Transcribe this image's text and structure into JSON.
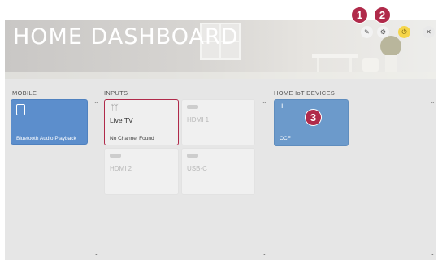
{
  "header": {
    "title": "HOME DASHBOARD",
    "buttons": {
      "edit_icon": "pencil-icon",
      "settings_icon": "gear-icon",
      "power_icon": "power-icon",
      "close_icon": "close-icon"
    },
    "callouts": [
      "1",
      "2",
      "3"
    ]
  },
  "sections": {
    "mobile": {
      "label": "MOBILE",
      "tiles": [
        {
          "label": "Bluetooth Audio Playback",
          "icon": "phone-speaker-icon"
        }
      ]
    },
    "inputs": {
      "label": "INPUTS",
      "tiles": [
        {
          "label": "Live TV",
          "status": "No Channel Found",
          "icon": "antenna-icon",
          "selected": true
        },
        {
          "label": "HDMI 1",
          "icon": "hdmi-icon"
        },
        {
          "label": "HDMI 2",
          "icon": "hdmi-icon"
        },
        {
          "label": "USB-C",
          "icon": "usb-icon"
        }
      ]
    },
    "iot": {
      "label": "HOME IoT DEVICES",
      "tiles": [
        {
          "label": "OCF",
          "icon": "plus-icon"
        }
      ]
    }
  },
  "colors": {
    "accent": "#b02a4a",
    "mobile_tile": "#5c8ecc",
    "iot_tile": "#6c9acb",
    "switch_button": "#f5d54a"
  }
}
